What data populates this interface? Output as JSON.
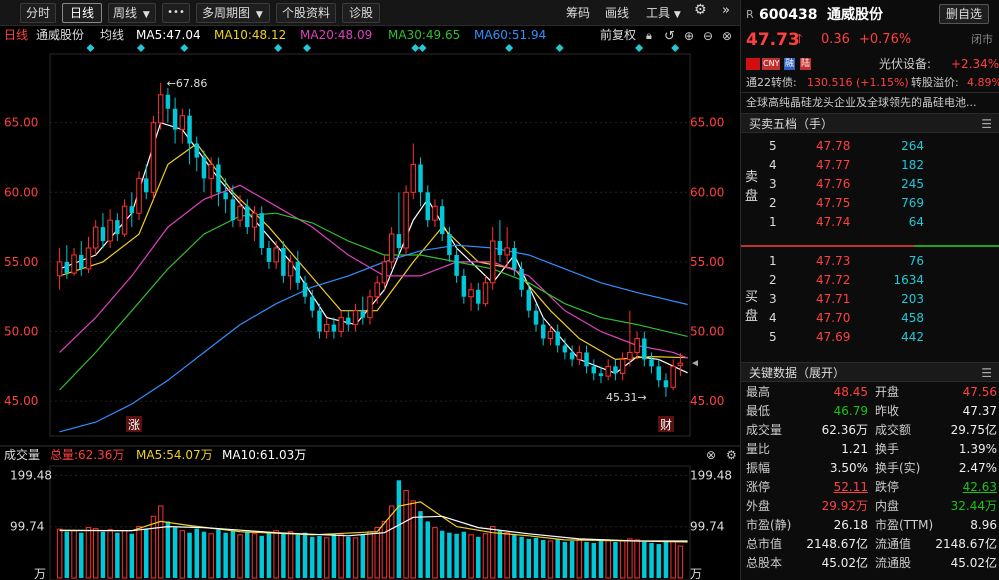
{
  "toolbar": {
    "tabs": [
      {
        "label": "分时",
        "active": false
      },
      {
        "label": "日线",
        "active": true
      },
      {
        "label": "周线",
        "active": false
      }
    ],
    "more_label": "•••",
    "multi_period_label": "多周期图",
    "profile_label": "个股资料",
    "diagnose_label": "诊股",
    "chips_label": "筹码",
    "draw_label": "画线",
    "tools_label": "工具"
  },
  "chart_header": {
    "period": "日线",
    "stock_name": "通威股份",
    "avg_label": "均线",
    "ma5": "MA5:47.04",
    "ma10": "MA10:48.12",
    "ma20": "MA20:48.09",
    "ma30": "MA30:49.65",
    "ma60": "MA60:51.94",
    "adjust": "前复权"
  },
  "colors": {
    "up": "#ff3030",
    "down": "#00c8d8",
    "ma5": "#ffffff",
    "ma10": "#f0d020",
    "ma20": "#e040c0",
    "ma30": "#30c030",
    "ma60": "#3090ff"
  },
  "chart_data": {
    "type": "candlestick",
    "ylim": [
      42.5,
      69.5
    ],
    "yticks": [
      "65.00",
      "60.00",
      "55.00",
      "50.00",
      "45.00"
    ],
    "yvalues": [
      65,
      60,
      55,
      50,
      45
    ],
    "high_label": "67.86",
    "low_label": "45.31",
    "markers": {
      "zhang": "涨",
      "cai": "财"
    },
    "candles": [
      [
        54.0,
        55.0,
        53.0,
        56.0
      ],
      [
        55.0,
        54.2,
        53.8,
        56.2
      ],
      [
        54.2,
        55.5,
        54.0,
        56.0
      ],
      [
        55.5,
        54.5,
        54.0,
        56.5
      ],
      [
        54.5,
        56.0,
        54.2,
        56.8
      ],
      [
        56.0,
        57.5,
        55.5,
        58.0
      ],
      [
        57.5,
        56.5,
        56.0,
        58.5
      ],
      [
        56.5,
        58.0,
        56.0,
        58.8
      ],
      [
        58.0,
        57.0,
        56.5,
        58.5
      ],
      [
        57.0,
        59.0,
        56.8,
        59.5
      ],
      [
        59.0,
        58.5,
        57.5,
        60.0
      ],
      [
        58.5,
        61.0,
        58.0,
        61.5
      ],
      [
        61.0,
        60.0,
        59.5,
        62.0
      ],
      [
        60.0,
        65.0,
        59.5,
        65.5
      ],
      [
        65.0,
        67.0,
        64.5,
        67.86
      ],
      [
        67.0,
        66.0,
        65.0,
        67.5
      ],
      [
        66.0,
        64.5,
        63.5,
        66.8
      ],
      [
        64.5,
        65.5,
        63.5,
        66.0
      ],
      [
        65.5,
        63.5,
        62.0,
        66.0
      ],
      [
        63.5,
        62.5,
        61.5,
        64.0
      ],
      [
        62.5,
        61.0,
        60.0,
        63.0
      ],
      [
        61.0,
        62.0,
        59.5,
        62.5
      ],
      [
        62.0,
        60.0,
        59.0,
        62.5
      ],
      [
        60.0,
        59.5,
        58.5,
        61.0
      ],
      [
        59.5,
        58.0,
        57.5,
        60.5
      ],
      [
        58.0,
        59.0,
        57.5,
        59.8
      ],
      [
        59.0,
        57.5,
        57.0,
        59.5
      ],
      [
        57.5,
        58.5,
        56.5,
        59.0
      ],
      [
        58.5,
        56.0,
        55.5,
        59.0
      ],
      [
        56.0,
        55.0,
        54.5,
        56.5
      ],
      [
        55.0,
        56.0,
        54.5,
        56.5
      ],
      [
        56.0,
        54.0,
        53.5,
        56.5
      ],
      [
        54.0,
        55.0,
        53.0,
        55.5
      ],
      [
        55.0,
        53.5,
        53.0,
        55.8
      ],
      [
        53.5,
        52.5,
        52.0,
        54.0
      ],
      [
        52.5,
        51.5,
        51.0,
        53.0
      ],
      [
        51.5,
        50.0,
        49.5,
        52.0
      ],
      [
        50.0,
        50.5,
        49.5,
        51.0
      ],
      [
        50.5,
        50.0,
        49.5,
        51.0
      ],
      [
        50.0,
        51.0,
        49.6,
        51.5
      ],
      [
        51.0,
        50.5,
        50.0,
        51.5
      ],
      [
        50.5,
        51.5,
        50.0,
        52.0
      ],
      [
        51.5,
        51.0,
        50.5,
        52.5
      ],
      [
        51.0,
        52.5,
        50.5,
        53.0
      ],
      [
        52.5,
        53.5,
        52.0,
        54.0
      ],
      [
        53.5,
        55.0,
        53.0,
        55.5
      ],
      [
        55.0,
        57.0,
        54.5,
        57.5
      ],
      [
        57.0,
        56.0,
        55.5,
        60.0
      ],
      [
        56.0,
        60.0,
        55.5,
        60.5
      ],
      [
        60.0,
        62.0,
        59.5,
        63.5
      ],
      [
        62.0,
        60.0,
        59.0,
        62.5
      ],
      [
        60.0,
        58.0,
        57.5,
        60.5
      ],
      [
        58.0,
        59.0,
        57.5,
        59.5
      ],
      [
        59.0,
        57.0,
        56.5,
        59.5
      ],
      [
        57.0,
        55.5,
        55.0,
        57.5
      ],
      [
        55.5,
        54.0,
        53.5,
        56.0
      ],
      [
        54.0,
        52.5,
        52.0,
        54.5
      ],
      [
        52.5,
        53.0,
        51.5,
        53.5
      ],
      [
        53.0,
        52.0,
        51.5,
        53.5
      ],
      [
        52.0,
        53.5,
        51.8,
        54.0
      ],
      [
        53.5,
        56.5,
        53.0,
        57.5
      ],
      [
        56.5,
        55.5,
        55.0,
        58.0
      ],
      [
        55.5,
        56.0,
        54.5,
        57.5
      ],
      [
        56.0,
        54.5,
        54.0,
        56.5
      ],
      [
        54.5,
        53.0,
        52.5,
        55.0
      ],
      [
        53.0,
        51.5,
        51.0,
        53.5
      ],
      [
        51.5,
        50.5,
        50.0,
        52.0
      ],
      [
        50.5,
        49.5,
        49.0,
        51.0
      ],
      [
        49.5,
        50.0,
        49.0,
        50.5
      ],
      [
        50.0,
        49.0,
        48.5,
        50.5
      ],
      [
        49.0,
        48.5,
        48.0,
        49.5
      ],
      [
        48.5,
        48.0,
        47.5,
        49.0
      ],
      [
        48.0,
        48.5,
        47.6,
        49.0
      ],
      [
        48.5,
        47.5,
        47.0,
        49.0
      ],
      [
        47.5,
        47.0,
        46.5,
        48.0
      ],
      [
        47.0,
        46.8,
        46.3,
        47.5
      ],
      [
        46.8,
        47.5,
        46.5,
        48.0
      ],
      [
        47.5,
        47.0,
        46.5,
        48.0
      ],
      [
        47.0,
        48.0,
        46.5,
        48.5
      ],
      [
        48.0,
        48.5,
        47.5,
        51.5
      ],
      [
        48.5,
        49.5,
        48.0,
        50.0
      ],
      [
        49.5,
        48.0,
        47.5,
        50.0
      ],
      [
        48.0,
        47.5,
        47.0,
        48.5
      ],
      [
        47.5,
        46.5,
        46.0,
        48.0
      ],
      [
        46.5,
        46.0,
        45.31,
        47.0
      ],
      [
        46.0,
        47.5,
        45.8,
        48.0
      ],
      [
        47.56,
        47.73,
        46.79,
        48.45
      ]
    ],
    "ma_lines": [
      {
        "name": "MA5",
        "color": "#ffffff",
        "points": [
          [
            0,
            54.5
          ],
          [
            5,
            55.5
          ],
          [
            10,
            58.5
          ],
          [
            14,
            65.0
          ],
          [
            17,
            64.5
          ],
          [
            22,
            61.0
          ],
          [
            27,
            58.0
          ],
          [
            32,
            55.0
          ],
          [
            37,
            51.0
          ],
          [
            41,
            50.5
          ],
          [
            45,
            53.0
          ],
          [
            49,
            58.0
          ],
          [
            51,
            59.5
          ],
          [
            55,
            56.0
          ],
          [
            60,
            53.5
          ],
          [
            63,
            55.5
          ],
          [
            67,
            51.0
          ],
          [
            72,
            48.0
          ],
          [
            77,
            47.0
          ],
          [
            80,
            48.2
          ],
          [
            83,
            48.0
          ],
          [
            87,
            47.04
          ]
        ]
      },
      {
        "name": "MA10",
        "color": "#f0d020",
        "points": [
          [
            0,
            54.0
          ],
          [
            6,
            55.0
          ],
          [
            11,
            57.0
          ],
          [
            15,
            62.0
          ],
          [
            19,
            63.5
          ],
          [
            24,
            60.0
          ],
          [
            29,
            57.5
          ],
          [
            34,
            54.5
          ],
          [
            39,
            51.5
          ],
          [
            44,
            51.5
          ],
          [
            49,
            55.0
          ],
          [
            53,
            57.5
          ],
          [
            58,
            55.0
          ],
          [
            63,
            54.5
          ],
          [
            68,
            51.5
          ],
          [
            72,
            49.5
          ],
          [
            77,
            48.0
          ],
          [
            82,
            48.2
          ],
          [
            87,
            48.12
          ]
        ]
      },
      {
        "name": "MA20",
        "color": "#e040c0",
        "points": [
          [
            0,
            48.5
          ],
          [
            5,
            51.0
          ],
          [
            10,
            54.0
          ],
          [
            15,
            57.5
          ],
          [
            20,
            59.5
          ],
          [
            25,
            60.5
          ],
          [
            30,
            59.0
          ],
          [
            35,
            57.5
          ],
          [
            40,
            55.5
          ],
          [
            45,
            54.0
          ],
          [
            50,
            54.0
          ],
          [
            55,
            55.0
          ],
          [
            60,
            55.0
          ],
          [
            65,
            54.0
          ],
          [
            70,
            51.5
          ],
          [
            75,
            50.0
          ],
          [
            80,
            49.0
          ],
          [
            85,
            48.5
          ],
          [
            87,
            48.09
          ]
        ]
      },
      {
        "name": "MA30",
        "color": "#30c030",
        "points": [
          [
            0,
            45.8
          ],
          [
            5,
            48.5
          ],
          [
            10,
            51.5
          ],
          [
            15,
            54.5
          ],
          [
            20,
            57.0
          ],
          [
            25,
            58.3
          ],
          [
            30,
            58.5
          ],
          [
            35,
            57.8
          ],
          [
            40,
            56.5
          ],
          [
            45,
            55.5
          ],
          [
            50,
            55.5
          ],
          [
            55,
            55.0
          ],
          [
            60,
            54.5
          ],
          [
            65,
            53.5
          ],
          [
            70,
            52.0
          ],
          [
            75,
            51.0
          ],
          [
            80,
            50.5
          ],
          [
            87,
            49.65
          ]
        ]
      },
      {
        "name": "MA60",
        "color": "#3090ff",
        "points": [
          [
            0,
            42.8
          ],
          [
            5,
            43.5
          ],
          [
            10,
            44.8
          ],
          [
            15,
            46.5
          ],
          [
            20,
            48.5
          ],
          [
            25,
            50.5
          ],
          [
            30,
            52.0
          ],
          [
            35,
            53.2
          ],
          [
            40,
            54.0
          ],
          [
            45,
            55.0
          ],
          [
            50,
            55.8
          ],
          [
            55,
            56.2
          ],
          [
            60,
            56.0
          ],
          [
            65,
            55.5
          ],
          [
            70,
            54.5
          ],
          [
            75,
            53.5
          ],
          [
            80,
            52.8
          ],
          [
            87,
            51.94
          ]
        ]
      }
    ]
  },
  "volume": {
    "title": "成交量",
    "total": "总量:62.36万",
    "ma5": "MA5:54.07万",
    "ma10": "MA10:61.03万",
    "ylim": [
      0,
      210
    ],
    "yticks": [
      "199.48",
      "99.74"
    ],
    "yvalues": [
      199.48,
      99.74
    ],
    "unit": "万",
    "bars": [
      95,
      90,
      92,
      88,
      98,
      96,
      90,
      94,
      88,
      92,
      86,
      100,
      95,
      120,
      140,
      110,
      98,
      92,
      88,
      96,
      90,
      86,
      94,
      88,
      92,
      84,
      90,
      86,
      82,
      88,
      92,
      86,
      90,
      84,
      88,
      80,
      82,
      78,
      86,
      84,
      80,
      78,
      84,
      90,
      98,
      110,
      140,
      190,
      170,
      150,
      130,
      110,
      98,
      92,
      88,
      86,
      90,
      84,
      80,
      86,
      100,
      92,
      88,
      84,
      80,
      76,
      78,
      74,
      72,
      76,
      70,
      72,
      74,
      70,
      68,
      72,
      74,
      70,
      72,
      76,
      74,
      70,
      68,
      66,
      70,
      72,
      62
    ],
    "ma_lines": [
      {
        "name": "MA5",
        "color": "#f0d020",
        "points": [
          [
            0,
            92
          ],
          [
            10,
            92
          ],
          [
            14,
            110
          ],
          [
            18,
            102
          ],
          [
            25,
            90
          ],
          [
            35,
            84
          ],
          [
            44,
            90
          ],
          [
            47,
            140
          ],
          [
            50,
            148
          ],
          [
            55,
            100
          ],
          [
            60,
            88
          ],
          [
            65,
            82
          ],
          [
            70,
            74
          ],
          [
            80,
            72
          ],
          [
            87,
            70
          ]
        ]
      },
      {
        "name": "MA10",
        "color": "#ffffff",
        "points": [
          [
            0,
            93
          ],
          [
            10,
            92
          ],
          [
            15,
            100
          ],
          [
            20,
            98
          ],
          [
            30,
            88
          ],
          [
            40,
            82
          ],
          [
            45,
            88
          ],
          [
            49,
            118
          ],
          [
            53,
            120
          ],
          [
            58,
            98
          ],
          [
            65,
            86
          ],
          [
            72,
            76
          ],
          [
            80,
            72
          ],
          [
            87,
            72
          ]
        ]
      }
    ]
  },
  "panel": {
    "code": "600438",
    "name": "通威股份",
    "remove_label": "删自选",
    "price": "47.73",
    "change": "0.36",
    "pct": "+0.76%",
    "status": "闭市",
    "tags": [
      "CNY",
      "融",
      "陆"
    ],
    "sector": "光伏设备:",
    "sector_pct": "+2.34%",
    "bond_label": "通22转债:",
    "bond_value": "130.516 (+1.15%)",
    "premium_label": "转股溢价:",
    "premium_value": "4.89%",
    "desc": "全球高纯晶硅龙头企业及全球领先的晶硅电池...",
    "book_title": "买卖五档（手）",
    "sell_label": "卖盘",
    "buy_label": "买盘",
    "asks": [
      [
        "5",
        "47.78",
        "264"
      ],
      [
        "4",
        "47.77",
        "182"
      ],
      [
        "3",
        "47.76",
        "245"
      ],
      [
        "2",
        "47.75",
        "769"
      ],
      [
        "1",
        "47.74",
        "64"
      ]
    ],
    "bids": [
      [
        "1",
        "47.73",
        "76"
      ],
      [
        "2",
        "47.72",
        "1634"
      ],
      [
        "3",
        "47.71",
        "203"
      ],
      [
        "4",
        "47.70",
        "458"
      ],
      [
        "5",
        "47.69",
        "442"
      ]
    ],
    "key_title": "关键数据（展开）",
    "stats": [
      [
        "最高",
        "48.45",
        "red",
        "开盘",
        "47.56",
        "red"
      ],
      [
        "最低",
        "46.79",
        "green",
        "昨收",
        "47.37",
        "white"
      ],
      [
        "成交量",
        "62.36万",
        "white",
        "成交额",
        "29.75亿",
        "white"
      ],
      [
        "量比",
        "1.21",
        "white",
        "换手",
        "1.39%",
        "white"
      ],
      [
        "振幅",
        "3.50%",
        "white",
        "换手(实)",
        "2.47%",
        "white"
      ],
      [
        "涨停",
        "52.11",
        "red",
        "跌停",
        "42.63",
        "green"
      ],
      [
        "外盘",
        "29.92万",
        "red",
        "内盘",
        "32.44万",
        "green"
      ],
      [
        "市盈(静)",
        "26.18",
        "white",
        "市盈(TTM)",
        "8.96",
        "white"
      ],
      [
        "总市值",
        "2148.67亿",
        "white",
        "流通值",
        "2148.67亿",
        "white"
      ],
      [
        "总股本",
        "45.02亿",
        "white",
        "流通股",
        "45.02亿",
        "white"
      ]
    ]
  }
}
